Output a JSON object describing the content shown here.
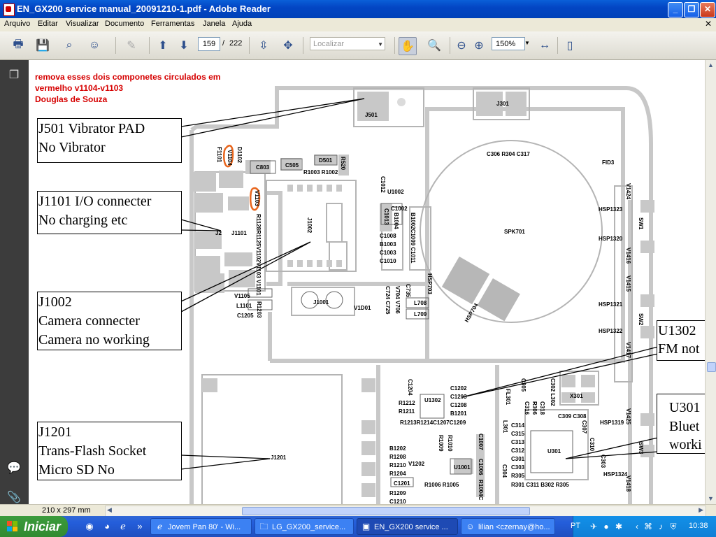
{
  "window": {
    "title": "EN_GX200 service manual_20091210-1.pdf - Adobe Reader"
  },
  "menu": [
    "Arquivo",
    "Editar",
    "Visualizar",
    "Documento",
    "Ferramentas",
    "Janela",
    "Ajuda"
  ],
  "toolbar": {
    "page_current": "159",
    "page_separator": "/",
    "page_total": "222",
    "search_placeholder": "Localizar",
    "zoom": "150%"
  },
  "status": {
    "page_size": "210 x 297 mm"
  },
  "note": {
    "line1": "remova esses dois componetes circulados em",
    "line2": "vermelho v1104-v1103",
    "line3": " Douglas de Souza"
  },
  "annotations": {
    "j501": [
      "J501 Vibrator PAD",
      "No Vibrator"
    ],
    "j1101": [
      "J1101 I/O connecter",
      "No charging etc"
    ],
    "j1002": [
      "J1002",
      "Camera connecter",
      "Camera no working"
    ],
    "j1201": [
      "J1201",
      "Trans-Flash Socket",
      "Micro SD No"
    ],
    "u1302": [
      "U1302",
      "FM not"
    ],
    "u301": [
      "U301",
      "Bluet",
      "worki"
    ]
  },
  "components": {
    "j501": "J501",
    "j301": "J301",
    "fid3": "FID3",
    "c306": "C306 R304 C317",
    "spk701": "SPK701",
    "u1002": "U1002",
    "c1012": "C1012",
    "c1008": "C1008",
    "b1003": "B1003",
    "c1003": "C1003",
    "c1010": "C1010",
    "c1002": "C1002",
    "c1013": "C1013",
    "b1004": "B1004",
    "b1002": "B1002C1009 C1011",
    "c803": "C803",
    "c505": "C505",
    "d501": "D501",
    "r1003": "R1003 R1002",
    "r520": "R520",
    "f1101": "F1101",
    "v1104": "V1104",
    "d1102": "D1102",
    "v1103": "V1103",
    "j1101": "J1101",
    "j2": "J2",
    "j1002": "J1002",
    "rchain": "R1128R1125V1102V1103 V1101",
    "v1105": "V1105",
    "l1101": "L1101",
    "c1205": "C1205",
    "r1203": "R1203",
    "j1001": "J1001",
    "vd1001": "V1D01",
    "l708": "L708",
    "l709": "L709",
    "hsp703": "HSP703",
    "hsp704": "HSP704",
    "c735": "C735",
    "c724": "C724 C725",
    "v704": "V704 V706",
    "hsp1323": "HSP1323",
    "hsp1320": "HSP1320",
    "hsp1321": "HSP1321",
    "hsp1322": "HSP1322",
    "hsp1319": "HSP1319",
    "hsp1324": "HSP1324",
    "sw1": "SW1",
    "sw2": "SW2",
    "sw3": "SW3",
    "v1424": "V1424",
    "v1416": "V1416",
    "v1415": "V1415",
    "v1417": "V1417",
    "v1425": "V1425",
    "v1418": "V1418",
    "c1204": "C1204",
    "u1302": "U1302",
    "r1212": "R1212",
    "r1211": "R1211",
    "c1202": "C1202",
    "c1203": "C1203",
    "c1208": "C1208",
    "b1201": "B1201",
    "r1213": "R1213R1214C1207C1209",
    "c305": "C305",
    "fl301": "FL301",
    "c302": "C302 L302",
    "x301": "X301",
    "r306": "R306",
    "c316": "C316",
    "c318": "C318",
    "c309": "C309 C308",
    "l301": "L301",
    "c314": "C314",
    "c315": "C315",
    "c313": "C313",
    "c312": "C312",
    "c301": "C301",
    "c303": "C303",
    "c304": "C304",
    "r305": "R305",
    "u301": "U301",
    "r301": "R301 C311 B302 R305",
    "c307": "C307",
    "c310": "C310",
    "c303b": "C303",
    "j1201": "J1201",
    "b1202": "B1202",
    "r1208": "R1208",
    "r1210": "R1210",
    "v1202": "V1202",
    "r1204": "R1204",
    "c1201": "C1201",
    "r1209": "R1209",
    "c1210": "C1210",
    "r1006": "R1006 R1005",
    "u1001": "U1001",
    "c1006": "C1006",
    "c1007": "C1007",
    "r1004": "R1004C",
    "r1010": "R1010",
    "r1009": "R1009"
  },
  "taskbar": {
    "start": "Iniciar",
    "tasks": [
      "Jovem Pan 80' - Wi...",
      "LG_GX200_service...",
      "EN_GX200 service ...",
      "lilian <czernay@ho..."
    ],
    "lang": "PT",
    "clock": "10:38"
  }
}
